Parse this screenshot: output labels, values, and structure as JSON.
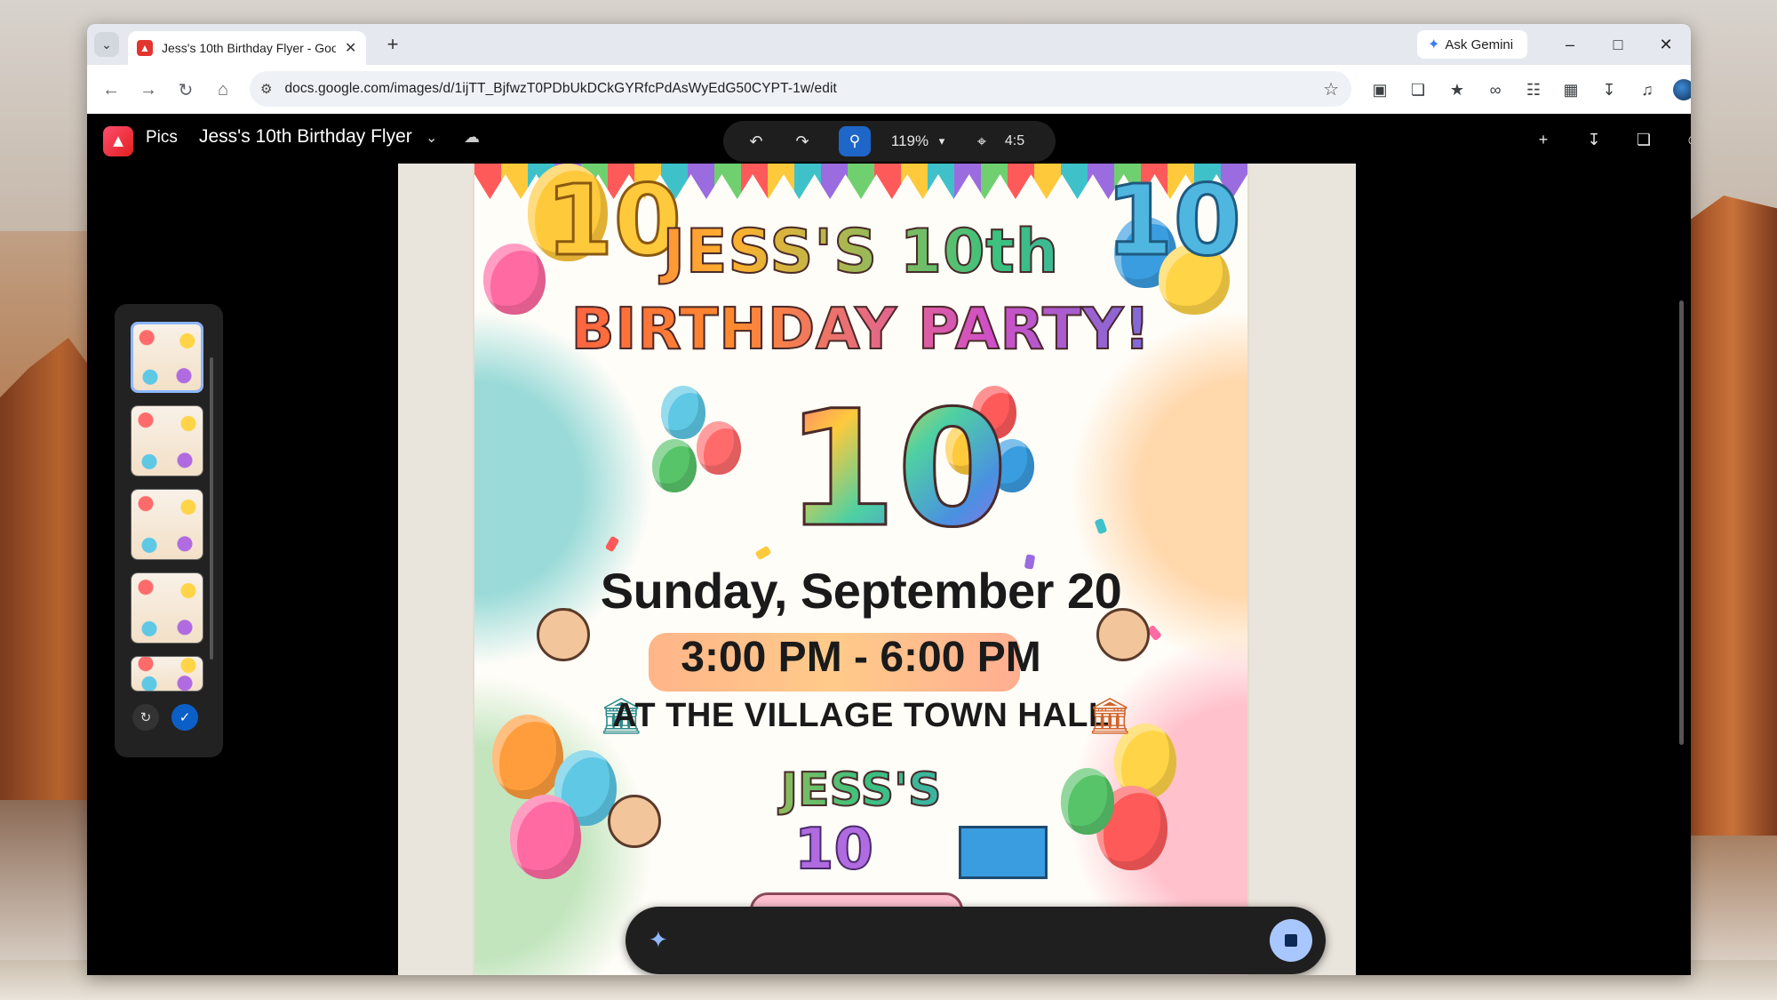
{
  "browser": {
    "tab_title": "Jess's 10th Birthday Flyer - Goo",
    "tab_favicon": "pics-logo-icon",
    "ask_gemini_label": "Ask Gemini",
    "url": "docs.google.com/images/d/1ijTT_BjfwzT0PDbUkDCkGYRfcPdAsWyEdG50CYPT-1w/edit"
  },
  "app": {
    "name": "Pics",
    "doc_title": "Jess's 10th Birthday Flyer",
    "zoom": "119%",
    "aspect_ratio": "4:5",
    "accent_color": "#1e66c8"
  },
  "thumbnails": {
    "count": 5,
    "selected_index": 0
  },
  "flyer": {
    "line1": "JESS'S 10th",
    "line2": "BIRTHDAY PARTY!",
    "big_number": "10",
    "corner_number": "10",
    "date": "Sunday, September 20",
    "time": "3:00 PM - 6:00 PM",
    "venue": "AT THE VILLAGE TOWN HALL",
    "cake_text": "JESS'S",
    "cake_number": "10"
  },
  "prompt": {
    "placeholder": ""
  }
}
